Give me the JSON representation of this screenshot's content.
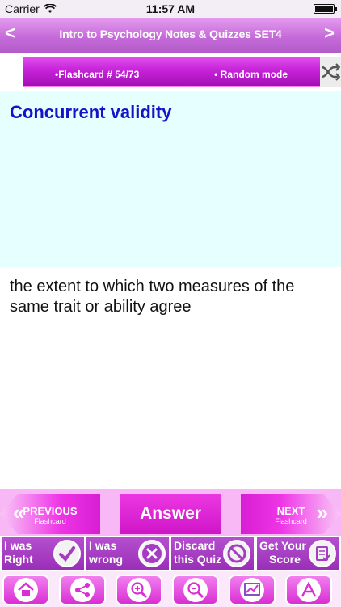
{
  "status_bar": {
    "carrier": "Carrier",
    "time": "11:57 AM"
  },
  "title_bar": {
    "title": "Intro to Psychology Notes & Quizzes SET4",
    "prev_glyph": "<",
    "next_glyph": ">"
  },
  "flashcard_bar": {
    "counter": "•Flashcard #  54/73",
    "mode": "• Random mode"
  },
  "card": {
    "question": "Concurrent validity",
    "answer": "the extent to which two measures of the same trait or ability agree"
  },
  "nav": {
    "previous_title": "PREVIOUS",
    "previous_sub": "Flashcard",
    "answer_label": "Answer",
    "next_title": "NEXT",
    "next_sub": "Flashcard"
  },
  "actions": {
    "right_line1": "I was",
    "right_line2": "Right",
    "wrong_line1": "I was",
    "wrong_line2": "wrong",
    "discard_line1": "Discard",
    "discard_line2": "this Quiz",
    "score_line1": "Get Your",
    "score_line2": "Score"
  },
  "tabs": [
    "home-icon",
    "share-icon",
    "zoom-in-icon",
    "zoom-out-icon",
    "chart-icon",
    "font-size-icon"
  ],
  "colors": {
    "accent": "#d81ed2",
    "question_text": "#1313c8",
    "question_bg": "#e6ffff",
    "action_purple": "#a53cc2"
  }
}
